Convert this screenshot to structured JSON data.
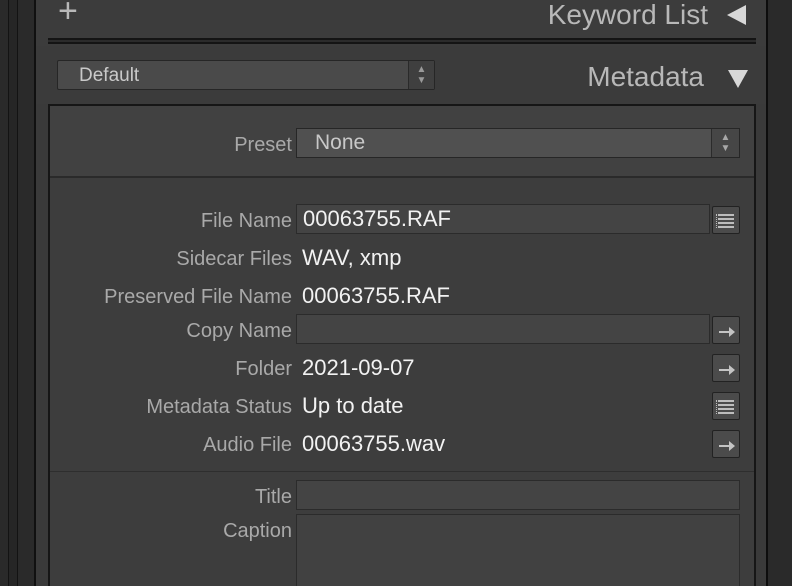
{
  "keyword_header": {
    "plus": "+",
    "title": "Keyword List"
  },
  "metadata_header": {
    "preset_select_value": "Default",
    "title": "Metadata"
  },
  "preset_row": {
    "label": "Preset",
    "value": "None"
  },
  "fields": {
    "file_name": {
      "label": "File Name",
      "value": "00063755.RAF",
      "button_icon": "list-icon"
    },
    "sidecar_files": {
      "label": "Sidecar Files",
      "value": "WAV, xmp"
    },
    "preserved_file_name": {
      "label": "Preserved File Name",
      "value": "00063755.RAF"
    },
    "copy_name": {
      "label": "Copy Name",
      "value": "",
      "button_icon": "arrow-right-icon"
    },
    "folder": {
      "label": "Folder",
      "value": "2021-09-07",
      "button_icon": "arrow-right-icon"
    },
    "metadata_status": {
      "label": "Metadata Status",
      "value": "Up to date",
      "button_icon": "list-icon"
    },
    "audio_file": {
      "label": "Audio File",
      "value": "00063755.wav",
      "button_icon": "arrow-right-icon"
    },
    "title": {
      "label": "Title",
      "value": ""
    },
    "caption": {
      "label": "Caption",
      "value": ""
    }
  },
  "colors": {
    "panel_bg": "#3a3a3a",
    "label": "#a9a9a9",
    "value": "#f2f2f2"
  }
}
